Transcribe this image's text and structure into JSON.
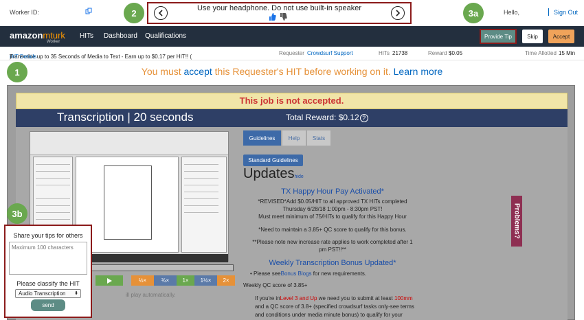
{
  "topbar": {
    "worker_id_label": "Worker ID:",
    "tip_text": "Use your headphone. Do not use built-in speaker",
    "hello": "Hello,",
    "sign_out": "Sign Out"
  },
  "badges": {
    "b1": "1",
    "b2": "2",
    "b3a": "3a",
    "b3b": "3b"
  },
  "nav": {
    "logo_amazon": "amazon",
    "logo_mturk": "mturk",
    "logo_worker": "Worker",
    "items": [
      "HITs",
      "Dashboard",
      "Qualifications"
    ],
    "provide_tip": "Provide Tip",
    "skip": "Skip",
    "accept": "Accept"
  },
  "hit_info": {
    "title": "Transcribe up to 35 Seconds of Media to Text - Earn up to $0.17 per HIT!! (",
    "details_link": "HIT Details",
    "title_close": ")",
    "requester_label": "Requester",
    "requester": "Crowdsurf Support",
    "hits_label": "HITs",
    "hits": "21738",
    "reward_label": "Reward",
    "reward": "$0.05",
    "time_label": "Time Allotted",
    "time": "15 Min"
  },
  "warning": {
    "pre": "You must ",
    "accept": "accept",
    "mid": " this Requester's HIT before working on it. ",
    "learn_more": "Learn more"
  },
  "hit_frame": {
    "not_accepted": "This job is not accepted.",
    "title": "Transcription | 20 seconds",
    "total_reward": "Total Reward: $0.12",
    "help_icon": "?",
    "tabs": [
      "Guidelines",
      "Help",
      "Stats"
    ],
    "standard_guidelines": "Standard Guidelines",
    "updates": "Updates",
    "hide": "hide",
    "tx_title": "TX Happy Hour Pay Activated*",
    "tx_line1": "*REVISED*Add $0.05/HIT to all approved TX HITs completed",
    "tx_line2": "Thursday 6/28/18 1:00pm - 8:30pm PST!",
    "tx_line3": "Must meet minimum of 75/HITs to qualify for this Happy Hour",
    "qc_note": "*Need to maintain a 3.85+ QC score to qualify for this bonus.",
    "rate_note1": "**Please note new increase rate applies to work completed after 1",
    "rate_note2": "pm PST!!**",
    "weekly_title": "Weekly Transcription Bonus Updated*",
    "bullet_pre": "Please see",
    "bonus_blogs": "Bonus Blogs",
    "bullet_post": " for new requirements.",
    "weekly_qc": "Weekly QC score of 3.85+",
    "level_pre": "If you're in",
    "level": "Level 3 and Up",
    "level_mid": " we need you to submit at least ",
    "level_amt": "100mm",
    "qc_line": "and a QC score of 3.8+ (specified crowdsurf tasks only-see terms",
    "cond_line": "and conditions under media minute bonus) to qualify for your",
    "problems": "Problems?",
    "speeds": [
      "½×",
      "¾×",
      "1×",
      "1½×",
      "2×"
    ],
    "autoplay": "ill play automatically."
  },
  "share": {
    "title": "Share your tips for others",
    "placeholder": "Maximum 100 characters",
    "classify_label": "Please classify the HIT",
    "selected": "Audio Transcription",
    "send": "send"
  }
}
